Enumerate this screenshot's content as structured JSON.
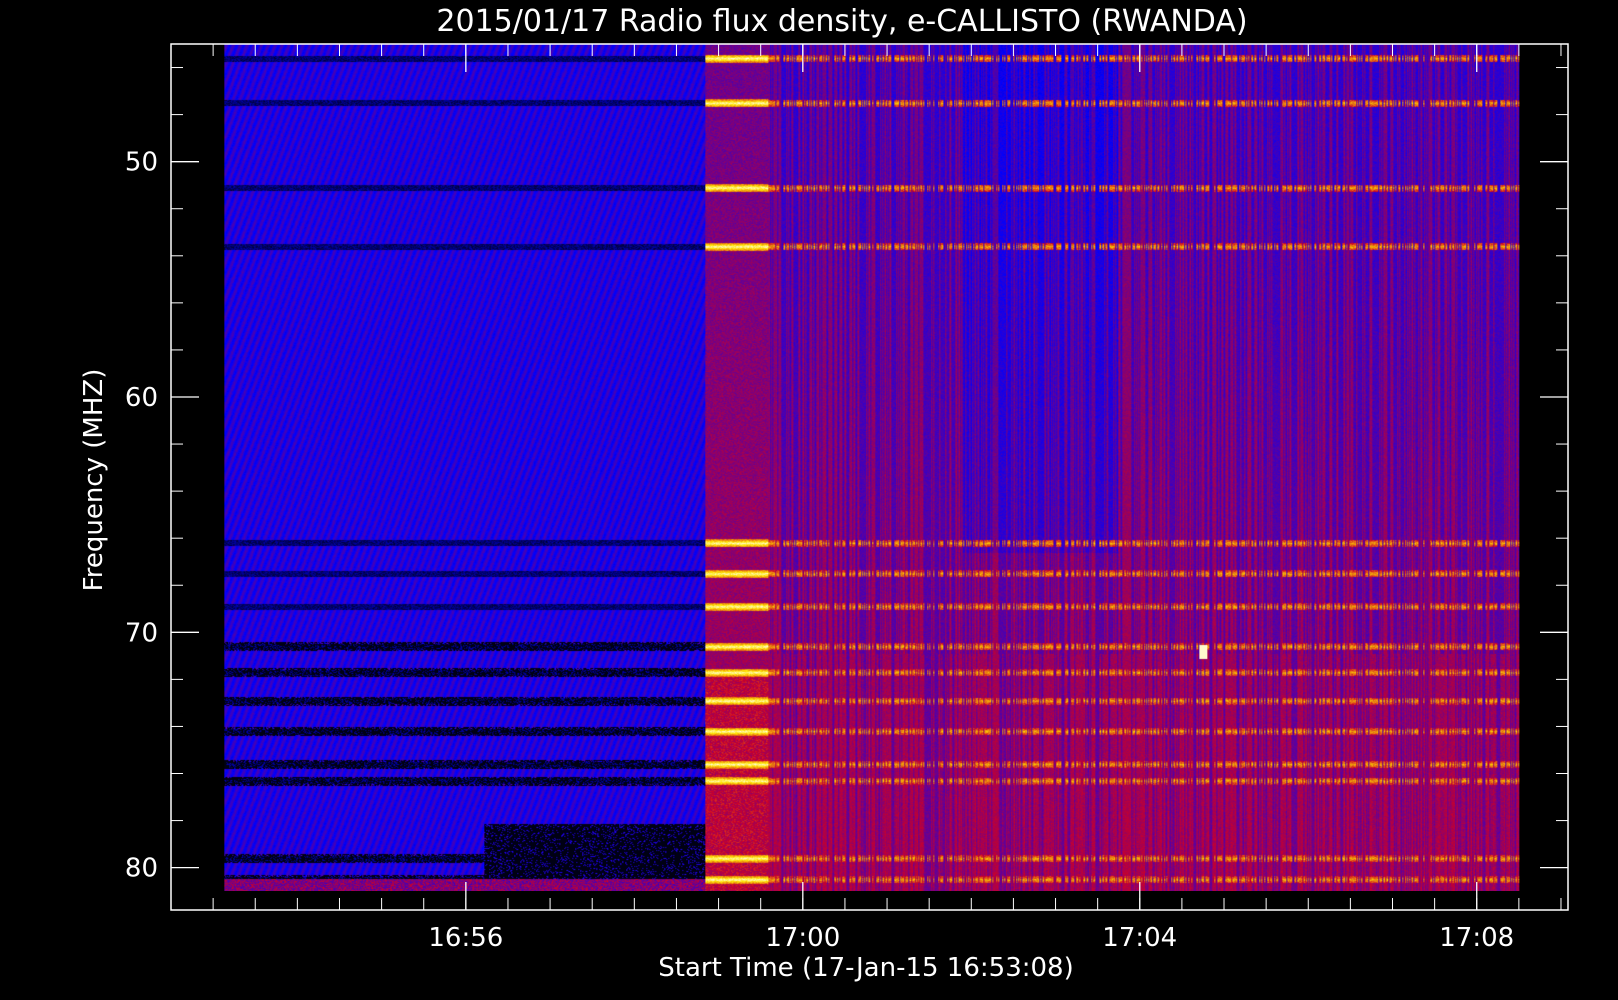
{
  "chart_data": {
    "type": "heatmap",
    "title": "2015/01/17  Radio flux density, e-CALLISTO (RWANDA)",
    "xlabel": "Start Time (17-Jan-15 16:53:08)",
    "ylabel": "Frequency (MHZ)",
    "x_unit": "UT (hh:mm) on 17-Jan-2015",
    "x_start": "16:53:08",
    "xlim": [
      "16:52:30",
      "17:09:05"
    ],
    "data_x_range": [
      "16:53:08",
      "17:08:30"
    ],
    "ylim": [
      45.0,
      81.8
    ],
    "data_y_range": [
      45.0,
      81.0
    ],
    "y_inverted": true,
    "x_ticks": [
      "16:56",
      "17:00",
      "17:04",
      "17:08"
    ],
    "y_ticks": [
      50,
      60,
      70,
      80
    ],
    "grid": false,
    "colormap": [
      "#000000",
      "#0000ff",
      "#cc0000",
      "#ffff00",
      "#ffffff"
    ],
    "events": [
      {
        "name": "receiver gain step",
        "start": "16:58:50",
        "end": "16:59:35",
        "freq_range": [
          45,
          81
        ]
      },
      {
        "name": "isolated burst",
        "time": "17:04:45",
        "freq_mhz": 70.8
      }
    ],
    "rfi_bands_mhz": [
      45.6,
      47.5,
      51.1,
      53.6,
      66.2,
      67.5,
      68.9,
      70.6,
      71.7,
      72.9,
      74.2,
      75.6,
      76.3,
      79.6,
      80.5
    ]
  }
}
